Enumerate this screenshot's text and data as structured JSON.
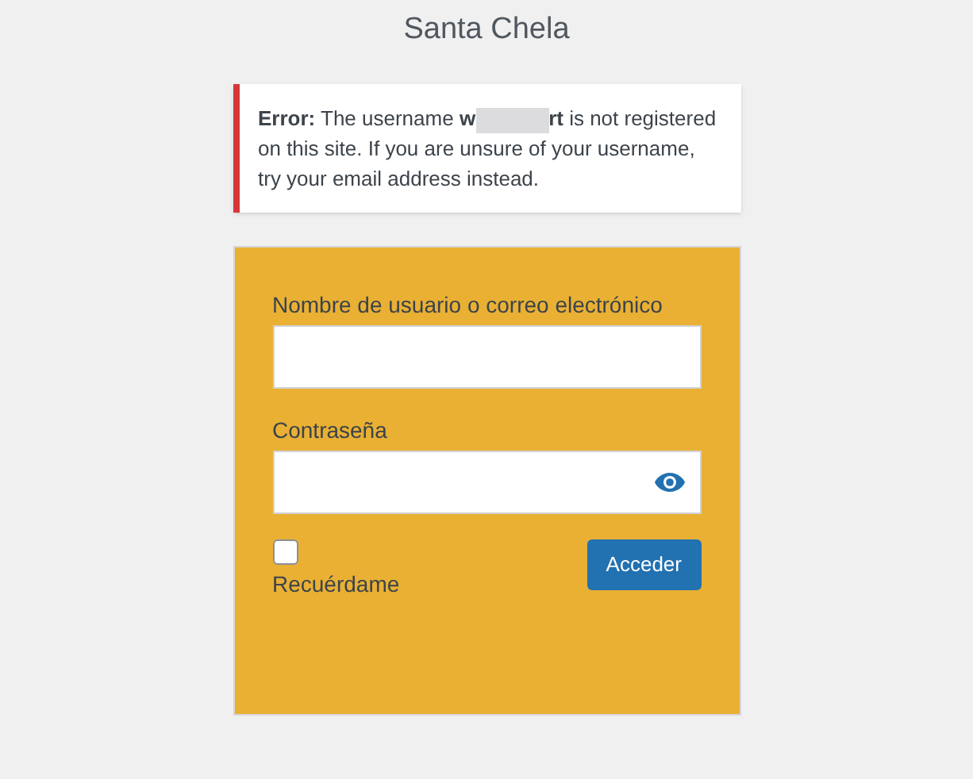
{
  "site_title": "Santa Chela",
  "notice": {
    "text_before": "**Error:** The username **w**",
    "text_after": "**rt** is not registered on this site. If you are unsure of your username, try your email address instead.",
    "redacted": true
  },
  "form": {
    "username_label": "Nombre de usuario o correo electrónico",
    "password_label": "Contraseña",
    "remember": {
      "label": "Recuérdame",
      "checked": false
    },
    "submit": "Acceder"
  }
}
